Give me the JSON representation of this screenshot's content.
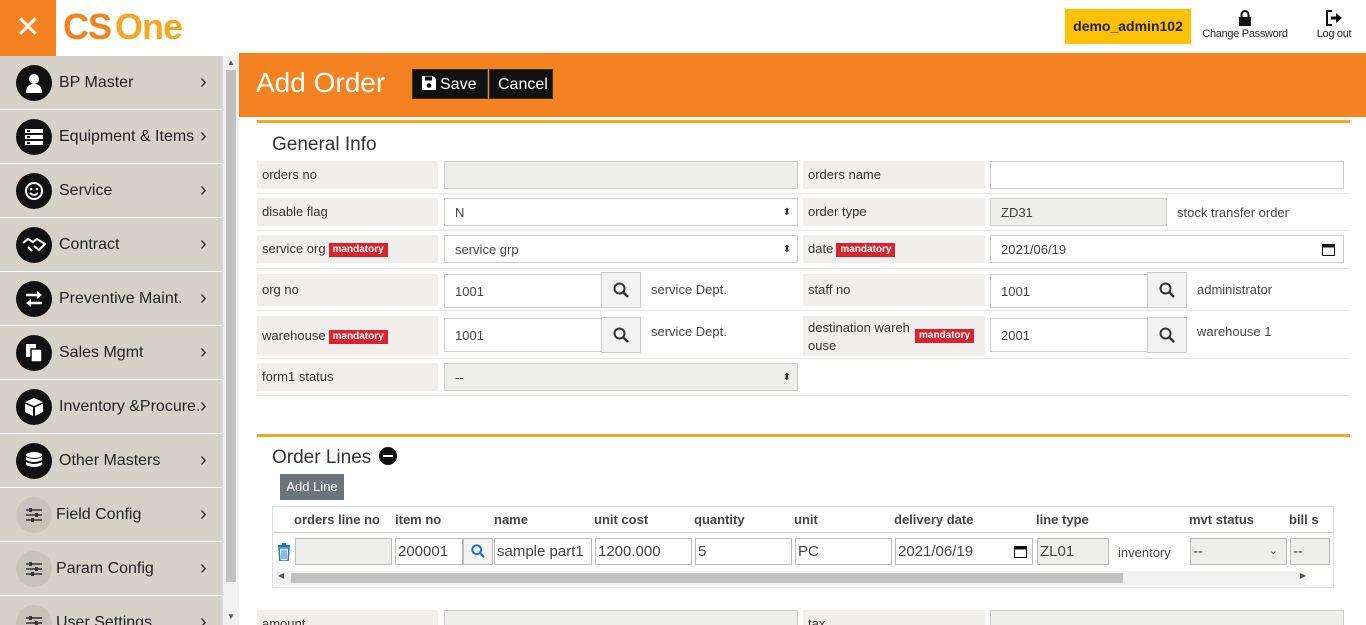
{
  "header": {
    "close_icon": "close-icon",
    "logo_cs": "CS",
    "logo_one": "One",
    "user": "demo_admin102",
    "change_password": "Change Password",
    "logout": "Log out"
  },
  "sidebar": {
    "items": [
      {
        "label": "BP Master",
        "icon": "user-icon"
      },
      {
        "label": "Equipment & Items",
        "icon": "server-icon"
      },
      {
        "label": "Service",
        "icon": "smile-icon"
      },
      {
        "label": "Contract",
        "icon": "handshake-icon"
      },
      {
        "label": "Preventive Maint.",
        "icon": "exchange-icon"
      },
      {
        "label": "Sales Mgmt",
        "icon": "copy-icon"
      },
      {
        "label": "Inventory &Procure.",
        "icon": "box-icon"
      },
      {
        "label": "Other Masters",
        "icon": "database-icon"
      },
      {
        "label": "Field Config",
        "icon": "sliders-icon"
      },
      {
        "label": "Param Config",
        "icon": "sliders-icon"
      },
      {
        "label": "User Settings",
        "icon": "sliders-icon"
      }
    ]
  },
  "page": {
    "title": "Add Order",
    "save": "Save",
    "cancel": "Cancel"
  },
  "general": {
    "title": "General Info",
    "mandatory": "mandatory",
    "orders_no_label": "orders no",
    "orders_no": "",
    "orders_name_label": "orders name",
    "orders_name": "",
    "disable_flag_label": "disable flag",
    "disable_flag": "N",
    "order_type_label": "order type",
    "order_type": "ZD31",
    "order_type_desc": "stock transfer order",
    "service_org_label": "service org",
    "service_org": "service grp",
    "date_label": "date",
    "date": "2021/06/19",
    "org_no_label": "org no",
    "org_no": "1001",
    "org_no_desc": "service Dept.",
    "staff_no_label": "staff no",
    "staff_no": "1001",
    "staff_no_desc": "administrator",
    "warehouse_label": "warehouse",
    "warehouse": "1001",
    "warehouse_desc": "service Dept.",
    "dest_wh_label_1": "destination wareh",
    "dest_wh_label_2": "ouse",
    "dest_wh": "2001",
    "dest_wh_desc": "warehouse 1",
    "form1_status_label": "form1 status",
    "form1_status": "--"
  },
  "lines": {
    "title": "Order Lines",
    "add_line": "Add Line",
    "columns": [
      "orders line no",
      "item no",
      "name",
      "unit cost",
      "quantity",
      "unit",
      "delivery date",
      "line type",
      "mvt status",
      "bill s"
    ],
    "row": {
      "line_no": "",
      "item_no": "200001",
      "name": "sample part1",
      "unit_cost": "1200.000",
      "quantity": "5",
      "unit": "PC",
      "delivery_date": "2021/06/19",
      "line_type": "ZL01",
      "line_type_desc": "inventory",
      "mvt_status": "--",
      "bill_status": "--"
    }
  },
  "footer": {
    "amount_label": "amount",
    "tax_label": "tax"
  }
}
